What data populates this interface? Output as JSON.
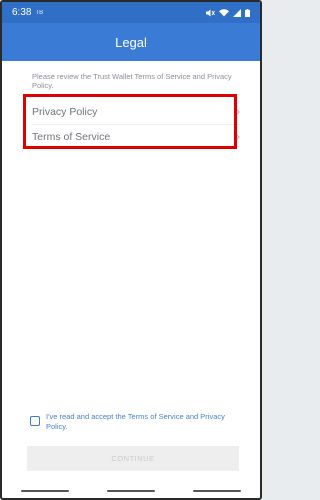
{
  "status_bar": {
    "time": "6:38",
    "carrier_badge": "TB",
    "icons": [
      "mute-icon",
      "wifi-icon",
      "signal-icon",
      "battery-icon"
    ]
  },
  "header": {
    "title": "Legal"
  },
  "intro_text": "Please review the Trust Wallet Terms of Service and Privacy Policy.",
  "items": [
    {
      "label": "Privacy Policy",
      "icon": "chevron-right-icon"
    },
    {
      "label": "Terms of Service",
      "icon": "chevron-right-icon"
    }
  ],
  "consent": {
    "checked": false,
    "text": "I've read and accept the Terms of Service and Privacy Policy."
  },
  "continue_button": {
    "label": "CONTINUE",
    "enabled": false
  },
  "colors": {
    "status_bar": "#2f6fc6",
    "app_bar": "#3a7bd5",
    "highlight_border": "#e00000",
    "consent_text": "#4a82c9",
    "button_disabled_bg": "#eeeeee"
  }
}
